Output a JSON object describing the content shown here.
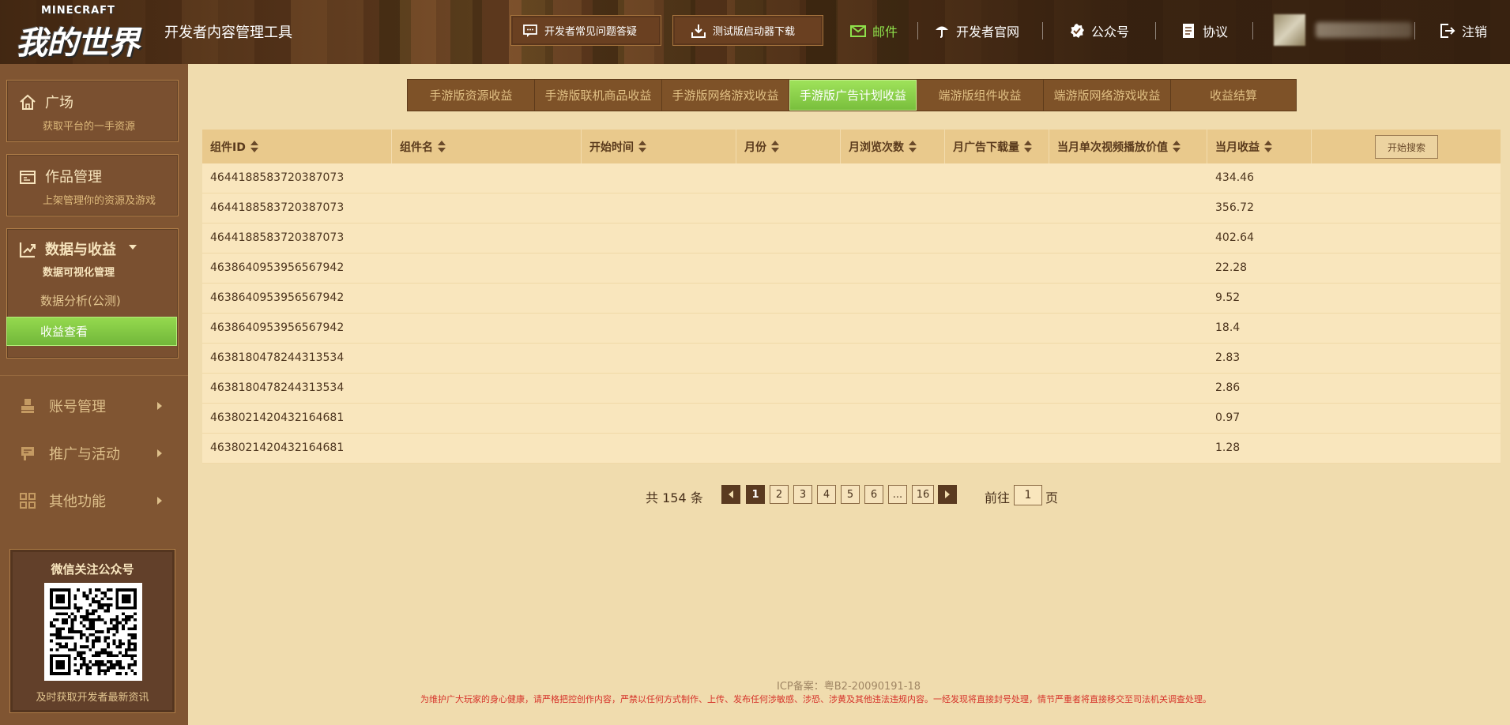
{
  "header": {
    "logo_top": "MINECRAFT",
    "logo_main": "我的世界",
    "app_title": "开发者内容管理工具",
    "faq_button": "开发者常见问题答疑",
    "download_button": "测试版启动器下载",
    "mail": "邮件",
    "dev_site": "开发者官网",
    "public_account": "公众号",
    "agreement": "协议",
    "logout": "注销"
  },
  "sidebar": {
    "plaza": {
      "title": "广场",
      "subtitle": "获取平台的一手资源"
    },
    "works": {
      "title": "作品管理",
      "subtitle": "上架管理你的资源及游戏"
    },
    "data": {
      "title": "数据与收益",
      "sub_label": "数据可视化管理",
      "items": [
        "数据分析(公测)",
        "收益查看"
      ]
    },
    "account": "账号管理",
    "promotion": "推广与活动",
    "others": "其他功能",
    "wechat_title": "微信关注公众号",
    "wechat_bottom": "及时获取开发者最新资讯"
  },
  "tabs": [
    "手游版资源收益",
    "手游版联机商品收益",
    "手游版网络游戏收益",
    "手游版广告计划收益",
    "端游版组件收益",
    "端游版网络游戏收益",
    "收益结算"
  ],
  "active_tab": "手游版广告计划收益",
  "table": {
    "columns": [
      "组件ID",
      "组件名",
      "开始时间",
      "月份",
      "月浏览次数",
      "月广告下载量",
      "当月单次视频播放价值",
      "当月收益"
    ],
    "search_button": "开始搜索",
    "rows": [
      {
        "id": "4644188583720387073",
        "income": "434.46"
      },
      {
        "id": "4644188583720387073",
        "income": "356.72"
      },
      {
        "id": "4644188583720387073",
        "income": "402.64"
      },
      {
        "id": "4638640953956567942",
        "income": "22.28"
      },
      {
        "id": "4638640953956567942",
        "income": "9.52"
      },
      {
        "id": "4638640953956567942",
        "income": "18.4"
      },
      {
        "id": "4638180478244313534",
        "income": "2.83"
      },
      {
        "id": "4638180478244313534",
        "income": "2.86"
      },
      {
        "id": "4638021420432164681",
        "income": "0.97"
      },
      {
        "id": "4638021420432164681",
        "income": "1.28"
      }
    ]
  },
  "pagination": {
    "total": "共 154 条",
    "pages": [
      "1",
      "2",
      "3",
      "4",
      "5",
      "6",
      "...",
      "16"
    ],
    "current": "1",
    "goto_prefix": "前往",
    "goto_value": "1",
    "goto_suffix": "页"
  },
  "footer": {
    "icp": "ICP备案：粤B2-20090191-18",
    "notice": "为维护广大玩家的身心健康，请严格把控创作内容，严禁以任何方式制作、上传、发布任何涉敏感、涉恐、涉黄及其他违法违规内容。一经发现将直接封号处理，情节严重者将直接移交至司法机关调查处理。"
  },
  "colors": {
    "accent_green": "#8ad44a",
    "header_brown": "#6a4021",
    "sidebar_brown": "#805532",
    "page_bg": "#f0dcae",
    "notice_red": "#d6342b"
  }
}
